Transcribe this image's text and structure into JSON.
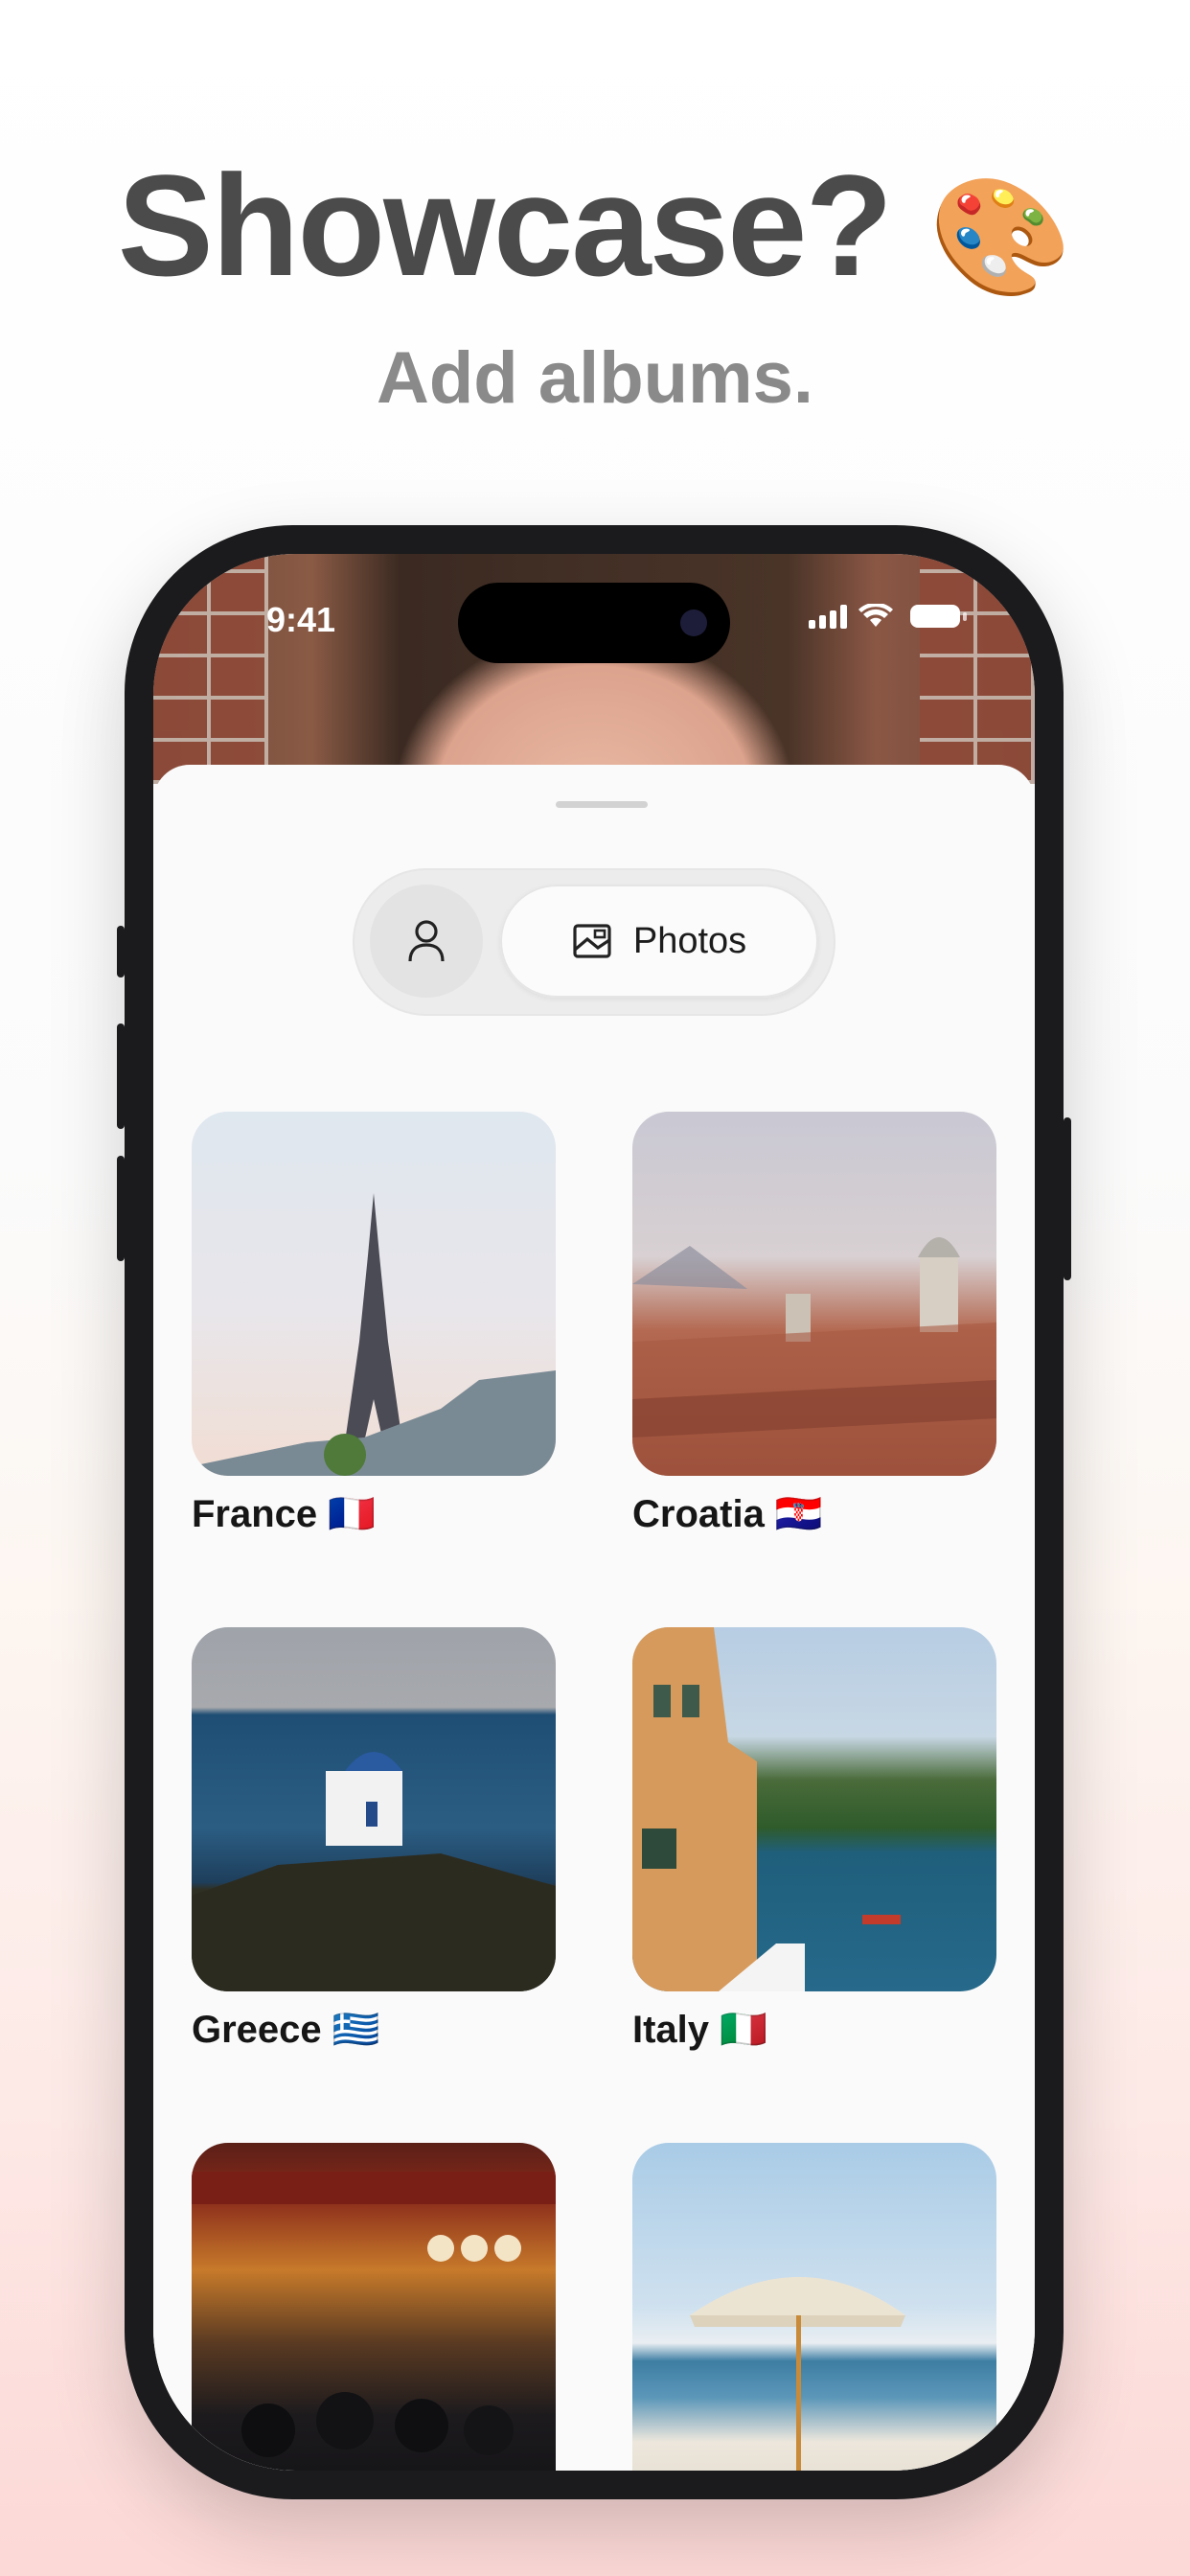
{
  "headline": {
    "title": "Showcase?",
    "emoji": "🎨",
    "subtitle": "Add albums."
  },
  "status_bar": {
    "time": "9:41"
  },
  "segmented_control": {
    "profile_icon": "person-icon",
    "photos_icon": "photo-icon",
    "photos_label": "Photos"
  },
  "albums": [
    {
      "title": "France 🇫🇷"
    },
    {
      "title": "Croatia 🇭🇷"
    },
    {
      "title": "Greece 🇬🇷"
    },
    {
      "title": "Italy 🇮🇹"
    },
    {
      "title": ""
    },
    {
      "title": ""
    }
  ],
  "colors": {
    "headline": "#4b4b4b",
    "subtitle": "#8a8a8a",
    "phone_frame": "#1b1b1d",
    "sheet": "#fafafa"
  }
}
